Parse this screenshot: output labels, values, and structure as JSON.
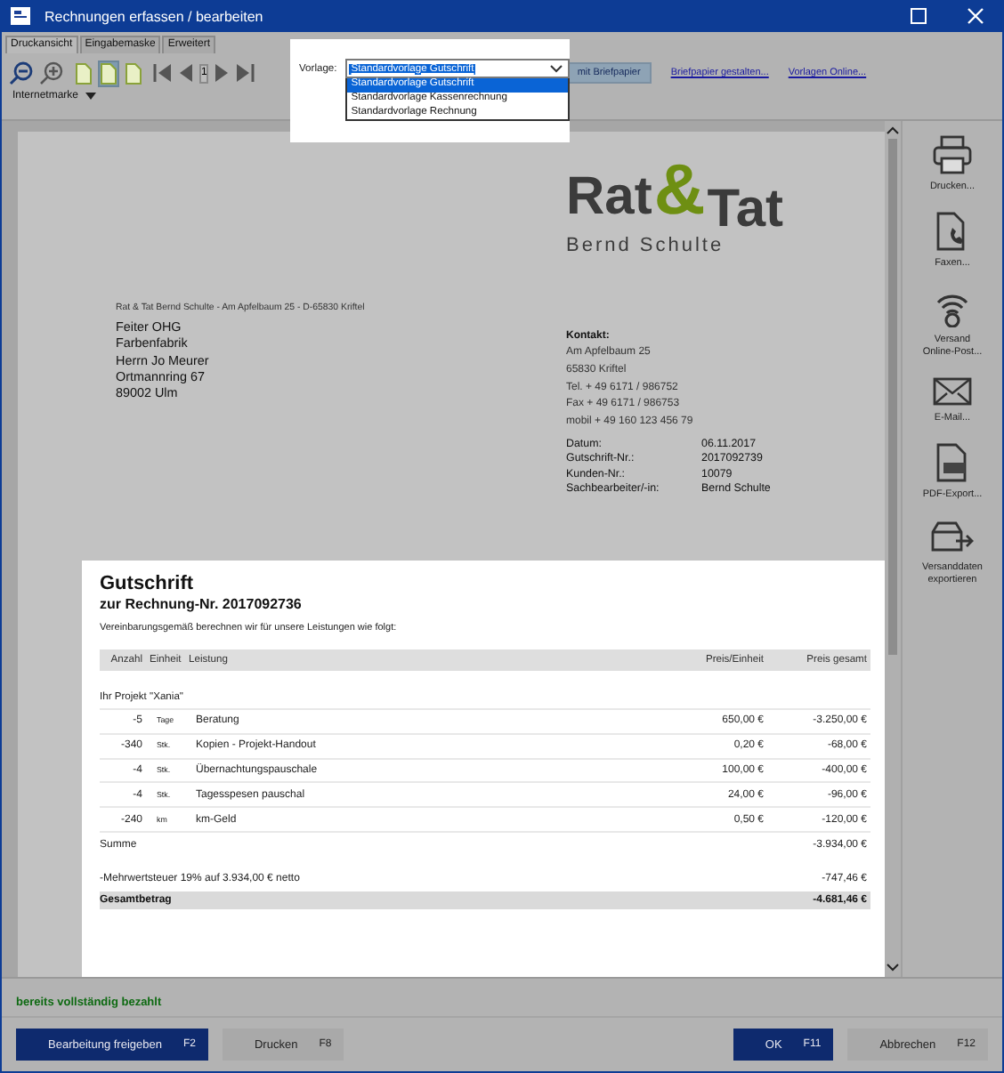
{
  "window": {
    "title": "Rechnungen erfassen / bearbeiten"
  },
  "tabs": [
    {
      "label": "Druckansicht",
      "selected": true
    },
    {
      "label": "Eingabemaske",
      "selected": false
    },
    {
      "label": "Erweitert",
      "selected": false
    }
  ],
  "toolbar": {
    "view_buttons": [
      {
        "selected": false
      },
      {
        "selected": true
      },
      {
        "selected": false
      }
    ],
    "page_number": "1",
    "stamp_menu": "Internetmarke",
    "letterhead_toggle": {
      "label": "mit Briefpapier",
      "selected": true
    },
    "links": [
      "Briefpapier gestalten...",
      "Vorlagen Online..."
    ]
  },
  "template": {
    "label": "Vorlage:",
    "value": "Standardvorlage Gutschrift",
    "options": [
      {
        "label": "Standardvorlage Gutschrift",
        "selected": true
      },
      {
        "label": "Standardvorlage Kassenrechnung",
        "selected": false
      },
      {
        "label": "Standardvorlage Rechnung",
        "selected": false
      }
    ]
  },
  "document": {
    "logo": {
      "word_1": "Rat",
      "ampersand": "&",
      "word_2": "Tat",
      "owner": "Bernd Schulte"
    },
    "sender_line": "Rat & Tat Bernd Schulte - Am Apfelbaum 25 - D-65830 Kriftel",
    "recipient": [
      "Feiter OHG",
      "Farbenfabrik",
      "Herrn Jo Meurer",
      "Ortmannring 67",
      "89002 Ulm"
    ],
    "contact": {
      "heading": "Kontakt:",
      "lines": [
        "Am Apfelbaum 25",
        "65830 Kriftel",
        "Tel. + 49 6171 / 986752",
        "Fax + 49 6171 / 986753",
        "mobil + 49 160 123 456 79"
      ]
    },
    "meta": [
      {
        "label": "Datum:",
        "value": "06.11.2017"
      },
      {
        "label": "Gutschrift-Nr.:",
        "value": "2017092739"
      },
      {
        "label": "Kunden-Nr.:",
        "value": "10079"
      },
      {
        "label": "Sachbearbeiter/-in:",
        "value": "Bernd Schulte"
      }
    ],
    "title": "Gutschrift",
    "subtitle": "zur Rechnung-Nr.  2017092736",
    "intro": "Vereinbarungsgemäß berechnen wir für unsere Leistungen wie folgt:",
    "columns": [
      "Anzahl",
      "Einheit",
      "Leistung",
      "Preis/Einheit",
      "Preis gesamt"
    ],
    "group": "Ihr Projekt \"Xania\"",
    "rows": [
      {
        "qty": "-5",
        "unit": "Tage",
        "desc": "Beratung",
        "unit_price": "650,00 €",
        "total": "-3.250,00 €"
      },
      {
        "qty": "-340",
        "unit": "Stk.",
        "desc": "Kopien - Projekt-Handout",
        "unit_price": "0,20 €",
        "total": "-68,00 €"
      },
      {
        "qty": "-4",
        "unit": "Stk.",
        "desc": "Übernachtungspauschale",
        "unit_price": "100,00 €",
        "total": "-400,00 €"
      },
      {
        "qty": "-4",
        "unit": "Stk.",
        "desc": "Tagesspesen pauschal",
        "unit_price": "24,00 €",
        "total": "-96,00 €"
      },
      {
        "qty": "-240",
        "unit": "km",
        "desc": "km-Geld",
        "unit_price": "0,50 €",
        "total": "-120,00 €"
      }
    ],
    "sum": {
      "label": "Summe",
      "value": "-3.934,00 €"
    },
    "tax": {
      "label": "-Mehrwertsteuer 19% auf 3.934,00 € netto",
      "value": "-747,46 €"
    },
    "total": {
      "label": "Gesamtbetrag",
      "value": "-4.681,46 €"
    }
  },
  "actions": [
    {
      "kind": "printer",
      "label": "Drucken..."
    },
    {
      "kind": "fax",
      "label": "Faxen..."
    },
    {
      "kind": "online",
      "label": "Versand\nOnline-Post..."
    },
    {
      "kind": "mail",
      "label": "E-Mail..."
    },
    {
      "kind": "pdf",
      "label": "PDF-Export..."
    },
    {
      "kind": "export",
      "label": "Versanddaten\nexportieren"
    }
  ],
  "status": "bereits vollständig bezahlt",
  "buttons_left": [
    {
      "label": "Bearbeitung freigeben",
      "shortcut": "F2",
      "kind": "primary"
    },
    {
      "label": "Drucken",
      "shortcut": "F8",
      "kind": "normal"
    }
  ],
  "buttons_right": [
    {
      "label": "OK",
      "shortcut": "F11",
      "kind": "primary"
    },
    {
      "label": "Abbrechen",
      "shortcut": "F12",
      "kind": "normal"
    }
  ]
}
